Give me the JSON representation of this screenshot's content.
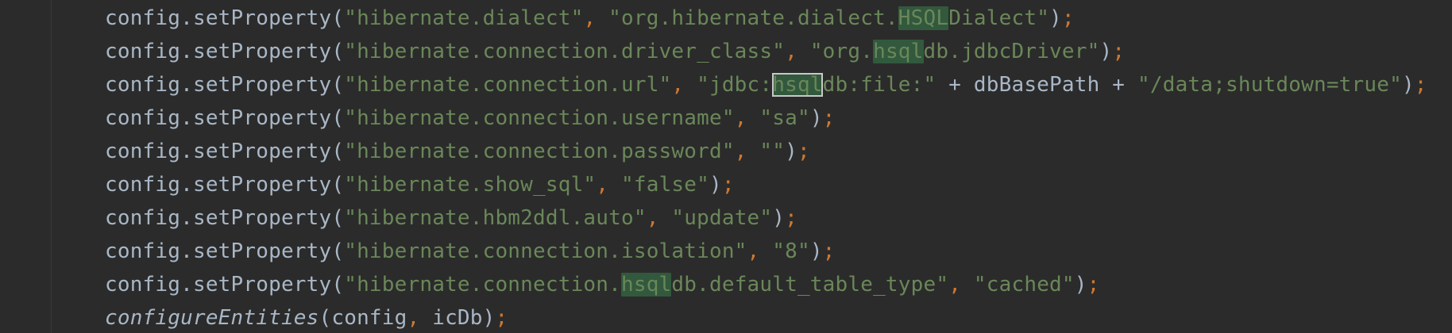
{
  "editor": {
    "lines": [
      [
        {
          "t": "config.setProperty(",
          "k": "plain"
        },
        {
          "t": "\"hibernate.dialect\"",
          "k": "string"
        },
        {
          "t": ", ",
          "k": "punct"
        },
        {
          "t": "\"org.hibernate.dialect.",
          "k": "string"
        },
        {
          "t": "HSQL",
          "k": "match"
        },
        {
          "t": "Dialect\"",
          "k": "string"
        },
        {
          "t": ")",
          "k": "plain"
        },
        {
          "t": ";",
          "k": "punct"
        }
      ],
      [
        {
          "t": "config.setProperty(",
          "k": "plain"
        },
        {
          "t": "\"hibernate.connection.driver_class\"",
          "k": "string"
        },
        {
          "t": ", ",
          "k": "punct"
        },
        {
          "t": "\"org.",
          "k": "string"
        },
        {
          "t": "hsql",
          "k": "match"
        },
        {
          "t": "db.jdbcDriver\"",
          "k": "string"
        },
        {
          "t": ")",
          "k": "plain"
        },
        {
          "t": ";",
          "k": "punct"
        }
      ],
      [
        {
          "t": "config.setProperty(",
          "k": "plain"
        },
        {
          "t": "\"hibernate.connection.url\"",
          "k": "string"
        },
        {
          "t": ", ",
          "k": "punct"
        },
        {
          "t": "\"jdbc:",
          "k": "string"
        },
        {
          "t": "hsql",
          "k": "match-current"
        },
        {
          "t": "db:file:\"",
          "k": "string"
        },
        {
          "t": " + dbBasePath + ",
          "k": "plain"
        },
        {
          "t": "\"/data;shutdown=true\"",
          "k": "string"
        },
        {
          "t": ")",
          "k": "plain"
        },
        {
          "t": ";",
          "k": "punct"
        }
      ],
      [
        {
          "t": "config.setProperty(",
          "k": "plain"
        },
        {
          "t": "\"hibernate.connection.username\"",
          "k": "string"
        },
        {
          "t": ", ",
          "k": "punct"
        },
        {
          "t": "\"sa\"",
          "k": "string"
        },
        {
          "t": ")",
          "k": "plain"
        },
        {
          "t": ";",
          "k": "punct"
        }
      ],
      [
        {
          "t": "config.setProperty(",
          "k": "plain"
        },
        {
          "t": "\"hibernate.connection.password\"",
          "k": "string"
        },
        {
          "t": ", ",
          "k": "punct"
        },
        {
          "t": "\"\"",
          "k": "string"
        },
        {
          "t": ")",
          "k": "plain"
        },
        {
          "t": ";",
          "k": "punct"
        }
      ],
      [
        {
          "t": "config.setProperty(",
          "k": "plain"
        },
        {
          "t": "\"hibernate.show_sql\"",
          "k": "string"
        },
        {
          "t": ", ",
          "k": "punct"
        },
        {
          "t": "\"false\"",
          "k": "string"
        },
        {
          "t": ")",
          "k": "plain"
        },
        {
          "t": ";",
          "k": "punct"
        }
      ],
      [
        {
          "t": "config.setProperty(",
          "k": "plain"
        },
        {
          "t": "\"hibernate.hbm2ddl.auto\"",
          "k": "string"
        },
        {
          "t": ", ",
          "k": "punct"
        },
        {
          "t": "\"update\"",
          "k": "string"
        },
        {
          "t": ")",
          "k": "plain"
        },
        {
          "t": ";",
          "k": "punct"
        }
      ],
      [
        {
          "t": "config.setProperty(",
          "k": "plain"
        },
        {
          "t": "\"hibernate.connection.isolation\"",
          "k": "string"
        },
        {
          "t": ", ",
          "k": "punct"
        },
        {
          "t": "\"8\"",
          "k": "string"
        },
        {
          "t": ")",
          "k": "plain"
        },
        {
          "t": ";",
          "k": "punct"
        }
      ],
      [
        {
          "t": "config.setProperty(",
          "k": "plain"
        },
        {
          "t": "\"hibernate.connection.",
          "k": "string"
        },
        {
          "t": "hsql",
          "k": "match"
        },
        {
          "t": "db.default_table_type\"",
          "k": "string"
        },
        {
          "t": ", ",
          "k": "punct"
        },
        {
          "t": "\"cached\"",
          "k": "string"
        },
        {
          "t": ")",
          "k": "plain"
        },
        {
          "t": ";",
          "k": "punct"
        }
      ],
      [
        {
          "t": "configureEntities",
          "k": "italic"
        },
        {
          "t": "(config",
          "k": "plain"
        },
        {
          "t": ", ",
          "k": "punct"
        },
        {
          "t": "icDb)",
          "k": "plain"
        },
        {
          "t": ";",
          "k": "punct"
        }
      ]
    ]
  }
}
